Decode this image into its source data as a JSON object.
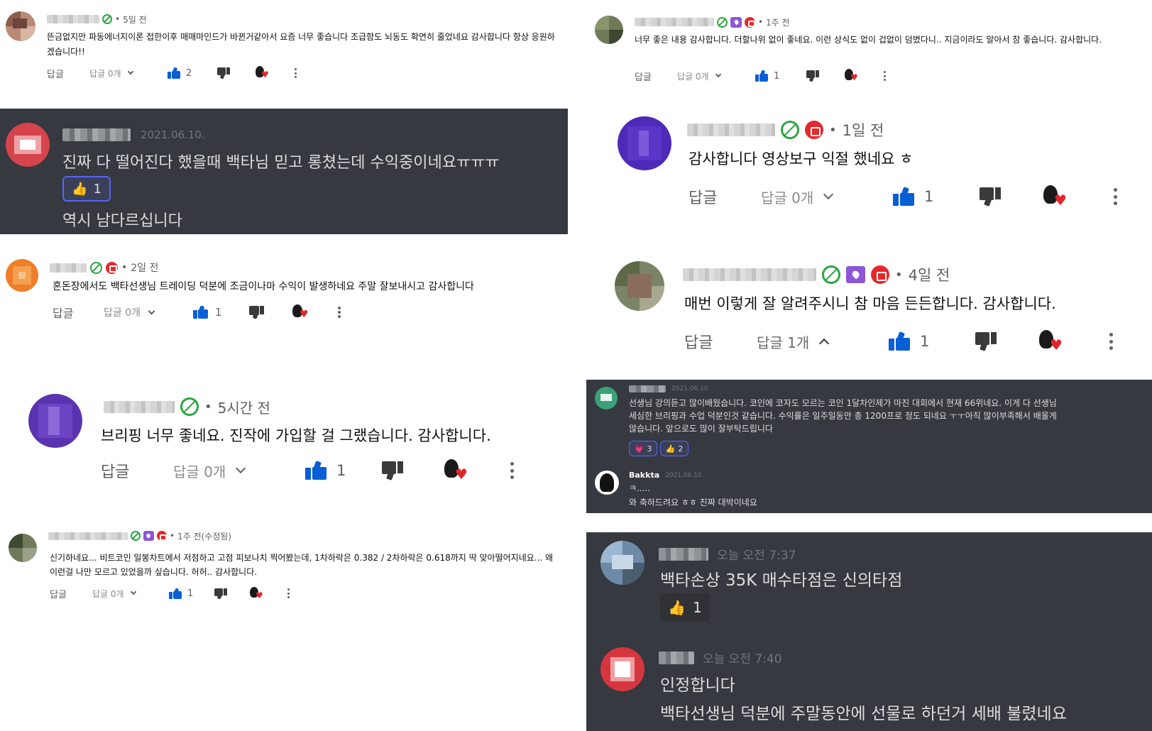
{
  "ui": {
    "reply": "답글",
    "more_icon": "more-vert-icon",
    "like_icon": "thumb-up-icon",
    "dislike_icon": "thumb-down-icon",
    "creator_heart_icon": "creator-heart-icon"
  },
  "colors": {
    "youtube_like_blue": "#065fd4",
    "discord_background": "#36393f",
    "discord_text": "#dcddde",
    "discord_timestamp": "#72767d",
    "badge_green": "#2ba640",
    "badge_purple": "#8e55d9",
    "badge_red": "#e5282c",
    "heart_red": "#e0262b"
  },
  "yt_comments": [
    {
      "id": "c1",
      "time": "5일 전",
      "badges": [
        "green"
      ],
      "text": "뜬금없지만 파동에너지이론 접한이후 매매마인드가 바뀐거같아서 요즘 너무 좋습니다 조급함도 뇌동도 확연히 줄었네요  감사합니다 항상 응원하겠습니다!!",
      "reply_count": "답글 0개",
      "likes": "2"
    },
    {
      "id": "c2",
      "time": "1주 전",
      "badges": [
        "green",
        "purple",
        "red"
      ],
      "text": "너무 좋은 내용 감사합니다. 더할나위 없이 좋네요. 이런 상식도 없이 겁없이 덤볐다니.. 지금이라도 알아서 참 좋습니다. 감사합니다.",
      "reply_count": "답글 0개",
      "likes": "1"
    },
    {
      "id": "c3",
      "time": "1일 전",
      "badges": [
        "green",
        "red"
      ],
      "text": "감사합니다 영상보구 익절 했네요 ㅎ",
      "reply_count": "답글 0개",
      "likes": "1"
    },
    {
      "id": "c4",
      "time": "2일 전",
      "badges": [
        "green",
        "red"
      ],
      "text": "혼돈장에서도 백타선생님 트레이딩 덕분에 조금이나마 수익이 발생하네요 주말 잘보내시고 감사합니다",
      "reply_count": "답글 0개",
      "likes": "1"
    },
    {
      "id": "c5",
      "time": "4일 전",
      "badges": [
        "green",
        "purple",
        "red"
      ],
      "text": "매번 이렇게 잘 알려주시니 참 마음 든든합니다. 감사합니다.",
      "reply_count": "답글 1개",
      "likes": "1"
    },
    {
      "id": "c6",
      "time": "5시간 전",
      "badges": [
        "green"
      ],
      "text": "브리핑 너무 좋네요. 진작에 가입할 걸 그랬습니다. 감사합니다.",
      "reply_count": "답글 0개",
      "likes": "1"
    },
    {
      "id": "c7",
      "time": "1주 전(수정됨)",
      "badges": [
        "green",
        "purple",
        "red"
      ],
      "text": "신기하네요... 비트코인 일봉차트에서 저점하고 고점 피보나치 찍어봤는데, 1차하락은 0.382 / 2차하락은 0.618까지 딱 맞아떨어지네요... 왜 이런걸 나만 모르고 있었을까 싶습니다. 허허.. 감사합니다.",
      "reply_count": "답글 0개",
      "likes": "1"
    }
  ],
  "discord_a": {
    "time": "2021.06.10.",
    "text": "진짜 다 떨어진다 했을때 백타님 믿고 롱쳤는데 수익중이네요ㅠㅠㅠ",
    "reaction_emoji": "👍",
    "reaction_count": "1",
    "text2": "역시 남다르십니다"
  },
  "discord_b": {
    "time": "2021.06.10.",
    "text_line1": "선생님 강의듣고 많이배웠습니다. 코인에 코자도 모르는 코인 1달차인제가 마진 대회에서 현재 66위네요.  이게 다 선생님",
    "text_line2": "세심한 브리핑과 수업 덕분인것 같습니다. 수익률은 일주일동안 총 1200프로 정도 되네요 ㅜㅜ아직 많이부족해서 배울게",
    "text_line3": "많습니다.  앞으로도 많이 잘부탁드립니다",
    "reactions": [
      {
        "emoji": "💗",
        "count": "3"
      },
      {
        "emoji": "👍",
        "count": "2"
      }
    ],
    "reply_name": "Bakkta",
    "reply_time": "2021.06.10.",
    "reply_text1": "ㅋ.....",
    "reply_text2": "와 축하드려요 ㅎㅎ 진짜 대박이네요"
  },
  "discord_c": {
    "msg1_time": "오늘 오전 7:37",
    "msg1_text": "백타손상 35K 매수타점은 신의타점",
    "msg1_reaction_emoji": "👍",
    "msg1_reaction_count": "1",
    "msg2_time": "오늘 오전 7:40",
    "msg2_text1": "인정합니다",
    "msg2_text2": "백타선생님 덕분에 주말동안에 선물로 하던거 세배 불렸네요"
  }
}
